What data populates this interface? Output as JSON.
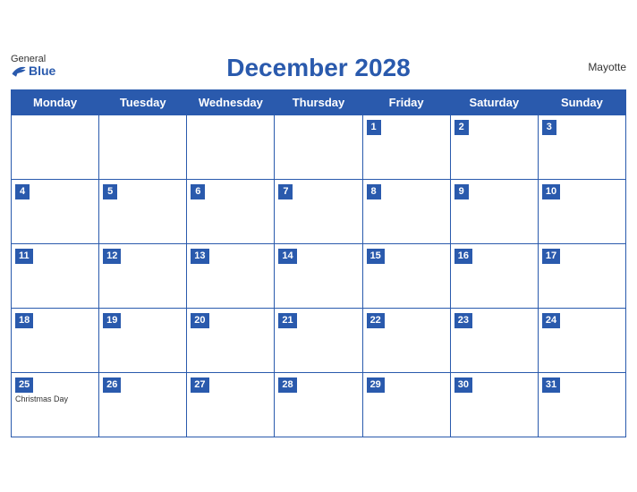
{
  "header": {
    "title": "December 2028",
    "region": "Mayotte",
    "logo_general": "General",
    "logo_blue": "Blue"
  },
  "weekdays": [
    "Monday",
    "Tuesday",
    "Wednesday",
    "Thursday",
    "Friday",
    "Saturday",
    "Sunday"
  ],
  "weeks": [
    [
      {
        "day": null,
        "holiday": ""
      },
      {
        "day": null,
        "holiday": ""
      },
      {
        "day": null,
        "holiday": ""
      },
      {
        "day": null,
        "holiday": ""
      },
      {
        "day": "1",
        "holiday": ""
      },
      {
        "day": "2",
        "holiday": ""
      },
      {
        "day": "3",
        "holiday": ""
      }
    ],
    [
      {
        "day": "4",
        "holiday": ""
      },
      {
        "day": "5",
        "holiday": ""
      },
      {
        "day": "6",
        "holiday": ""
      },
      {
        "day": "7",
        "holiday": ""
      },
      {
        "day": "8",
        "holiday": ""
      },
      {
        "day": "9",
        "holiday": ""
      },
      {
        "day": "10",
        "holiday": ""
      }
    ],
    [
      {
        "day": "11",
        "holiday": ""
      },
      {
        "day": "12",
        "holiday": ""
      },
      {
        "day": "13",
        "holiday": ""
      },
      {
        "day": "14",
        "holiday": ""
      },
      {
        "day": "15",
        "holiday": ""
      },
      {
        "day": "16",
        "holiday": ""
      },
      {
        "day": "17",
        "holiday": ""
      }
    ],
    [
      {
        "day": "18",
        "holiday": ""
      },
      {
        "day": "19",
        "holiday": ""
      },
      {
        "day": "20",
        "holiday": ""
      },
      {
        "day": "21",
        "holiday": ""
      },
      {
        "day": "22",
        "holiday": ""
      },
      {
        "day": "23",
        "holiday": ""
      },
      {
        "day": "24",
        "holiday": ""
      }
    ],
    [
      {
        "day": "25",
        "holiday": "Christmas Day"
      },
      {
        "day": "26",
        "holiday": ""
      },
      {
        "day": "27",
        "holiday": ""
      },
      {
        "day": "28",
        "holiday": ""
      },
      {
        "day": "29",
        "holiday": ""
      },
      {
        "day": "30",
        "holiday": ""
      },
      {
        "day": "31",
        "holiday": ""
      }
    ]
  ]
}
